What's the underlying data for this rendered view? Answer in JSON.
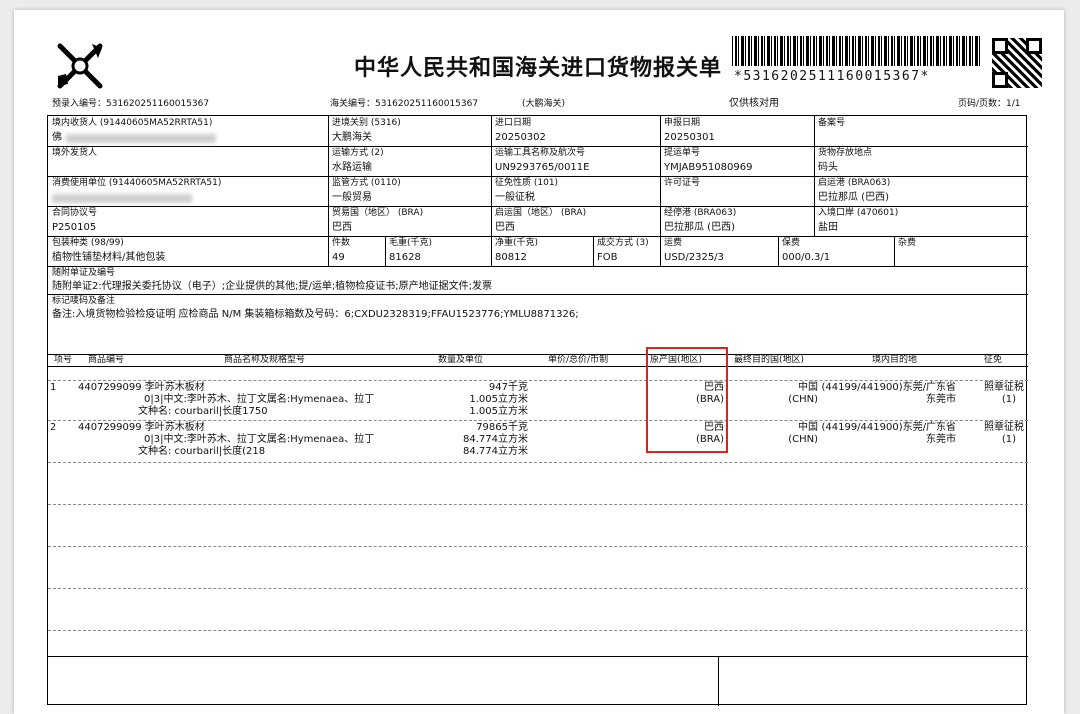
{
  "header": {
    "title": "中华人民共和国海关进口货物报关单",
    "barcode_text": "*5316202511160015367*",
    "preentry": "预录入编号：531620251160015367",
    "customs_no": "海关编号：531620251160015367",
    "customs_name": "(大鹏海关)",
    "check_only": "仅供核对用",
    "page": "页码/页数：1/1"
  },
  "fields": {
    "consignee_label": "境内收货人 (91440605MA52RRTA51)",
    "consignee_value": "佛",
    "entry_customs_label": "进境关别 (5316)",
    "entry_customs_value": "大鹏海关",
    "import_date_label": "进口日期",
    "import_date_value": "20250302",
    "declare_date_label": "申报日期",
    "declare_date_value": "20250301",
    "record_label": "备案号",
    "overseas_shipper_label": "境外发货人",
    "transport_mode_label": "运输方式 (2)",
    "transport_mode_value": "水路运输",
    "vessel_label": "运输工具名称及航次号",
    "vessel_value": "UN9293765/0011E",
    "bl_label": "提运单号",
    "bl_value": "YMJAB951080969",
    "storage_label": "货物存放地点",
    "storage_value": "码头",
    "consumer_label": "消费使用单位 (91440605MA52RRTA51)",
    "supervision_label": "监管方式 (0110)",
    "supervision_value": "一般贸易",
    "levy_label": "征免性质 (101)",
    "levy_value": "一般征税",
    "license_label": "许可证号",
    "departure_port_label": "启运港 (BRA063)",
    "departure_port_value": "巴拉那瓜 (巴西)",
    "contract_label": "合同协议号",
    "contract_value": "P250105",
    "trade_country_label": "贸易国（地区） (BRA)",
    "trade_country_value": "巴西",
    "origin_country_label": "启运国（地区） (BRA)",
    "origin_country_value": "巴西",
    "transit_port_label": "经停港 (BRA063)",
    "transit_port_value": "巴拉那瓜 (巴西)",
    "entry_port_label": "入境口岸 (470601)",
    "entry_port_value": "盐田",
    "package_label": "包装种类 (98/99)",
    "package_value": "植物性铺垫材料/其他包装",
    "pieces_label": "件数",
    "pieces_value": "49",
    "gross_label": "毛重(千克)",
    "gross_value": "81628",
    "net_label": "净重(千克)",
    "net_value": "80812",
    "deal_label": "成交方式 (3)",
    "deal_value": "FOB",
    "freight_label": "运费",
    "freight_value": "USD/2325/3",
    "insurance_label": "保费",
    "insurance_value": "000/0.3/1",
    "misc_label": "杂费",
    "docs_label": "随附单证及编号",
    "docs_value": "随附单证2:代理报关委托协议（电子）;企业提供的其他;提/运单;植物检疫证书;原产地证据文件;发票",
    "marks_label": "标记唛码及备注",
    "marks_value": "备注:入境货物检验检疫证明 应检商品 N/M  集装箱标箱数及号码：6;CXDU2328319;FFAU1523776;YMLU8871326;"
  },
  "goods_headers": {
    "no": "项号",
    "code": "商品编号",
    "name": "商品名称及规格型号",
    "qty": "数量及单位",
    "price": "单价/总价/币制",
    "origin": "原产国(地区)",
    "dest": "最终目的国(地区)",
    "domestic": "境内目的地",
    "levy": "征免"
  },
  "goods": [
    {
      "no": "1",
      "code_name": "4407299099 李叶苏木板材",
      "spec1": "0|3|中文:李叶苏木、拉丁文属名:Hymenaea、拉丁",
      "spec2": "文种名: courbaril|长度1750",
      "qty1": "947千克",
      "qty2": "1.005立方米",
      "qty3": "1.005立方米",
      "origin": "巴西",
      "origin_code": "(BRA)",
      "dest": "中国",
      "dest_code": "(CHN)",
      "domestic1": "(44199/441900)东莞/广东省",
      "domestic2": "东莞市",
      "levy1": "照章征税",
      "levy2": "(1)"
    },
    {
      "no": "2",
      "code_name": "4407299099 李叶苏木板材",
      "spec1": "0|3|中文:李叶苏木、拉丁文属名:Hymenaea、拉丁",
      "spec2": "文种名: courbaril|长度(218",
      "qty1": "79865千克",
      "qty2": "84.774立方米",
      "qty3": "84.774立方米",
      "origin": "巴西",
      "origin_code": "(BRA)",
      "dest": "中国",
      "dest_code": "(CHN)",
      "domestic1": "(44199/441900)东莞/广东省",
      "domestic2": "东莞市",
      "levy1": "照章征税",
      "levy2": "(1)"
    }
  ],
  "colors": {
    "highlight": "#e02020"
  },
  "icons": {
    "logo": "customs-emblem-icon",
    "qr": "qr-code-icon"
  }
}
